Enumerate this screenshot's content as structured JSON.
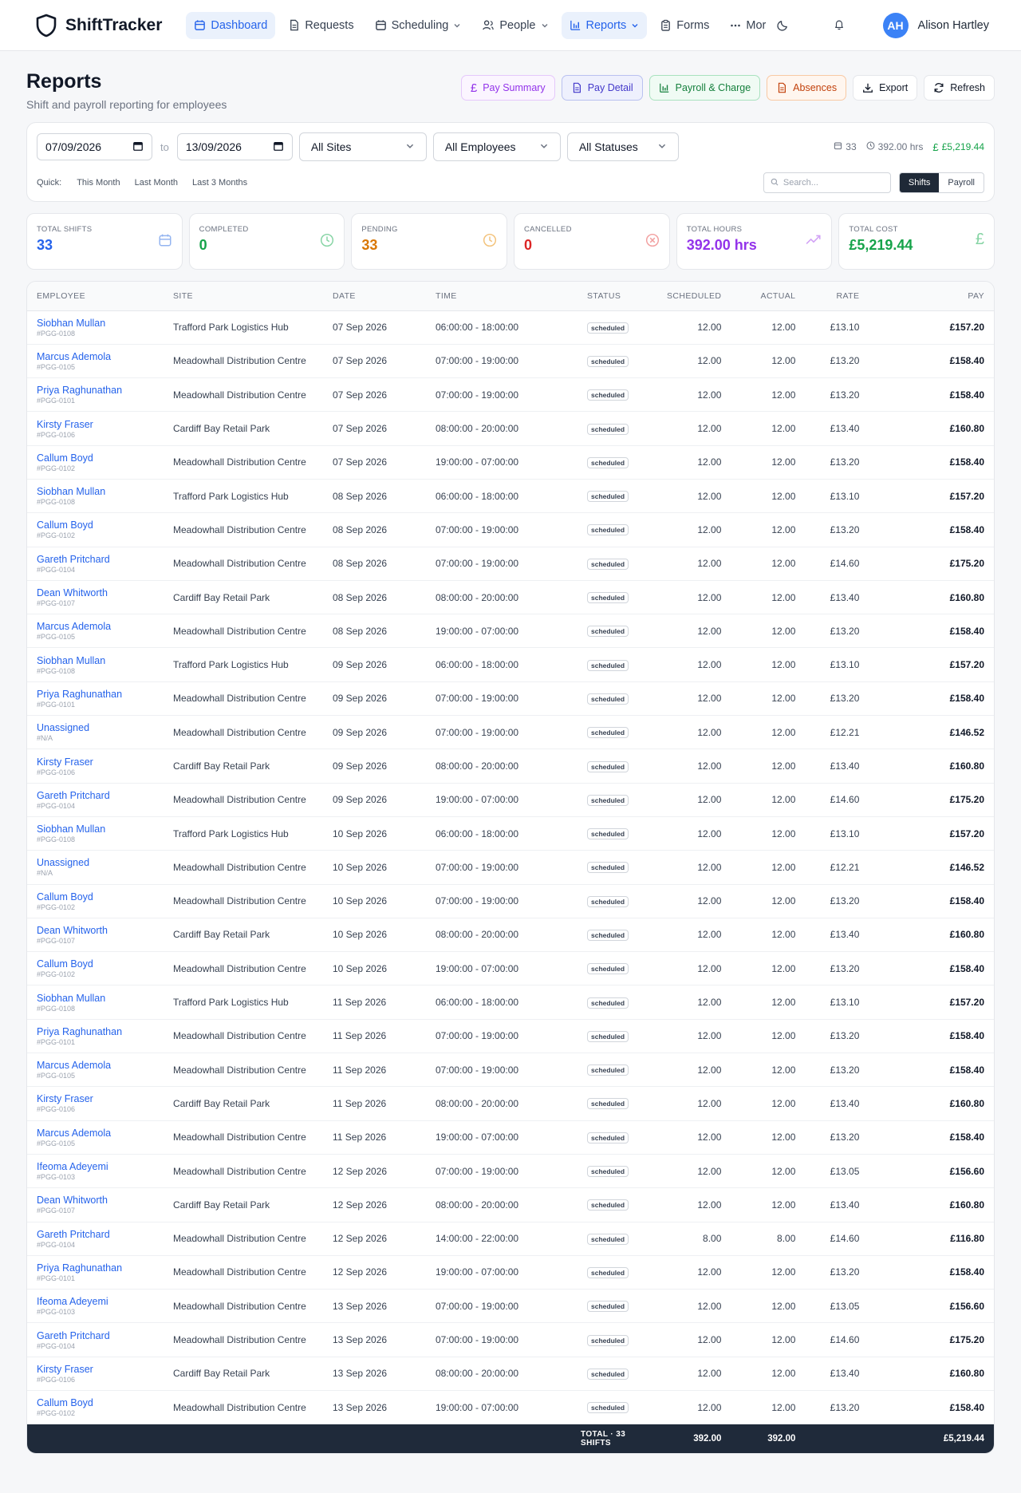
{
  "app": {
    "name": "ShiftTracker"
  },
  "nav": {
    "items": [
      {
        "label": "Dashboard",
        "icon": "calendar-icon",
        "active": true
      },
      {
        "label": "Requests",
        "icon": "document-icon"
      },
      {
        "label": "Scheduling",
        "icon": "calendar-icon",
        "dropdown": true
      },
      {
        "label": "People",
        "icon": "people-icon",
        "dropdown": true
      },
      {
        "label": "Reports",
        "icon": "bar-chart-icon",
        "dropdown": true,
        "active": true
      },
      {
        "label": "Forms",
        "icon": "clipboard-icon"
      },
      {
        "label": "Mor",
        "icon": "more-icon"
      }
    ],
    "user": {
      "initials": "AH",
      "name": "Alison Hartley"
    }
  },
  "page": {
    "title": "Reports",
    "subtitle": "Shift and payroll reporting for employees",
    "buttons": {
      "pay_summary": "Pay Summary",
      "pay_detail": "Pay Detail",
      "payroll_charge": "Payroll & Charge",
      "absences": "Absences",
      "export": "Export",
      "refresh": "Refresh"
    }
  },
  "filters": {
    "date_from": "07/09/2026",
    "to_label": "to",
    "date_to": "13/09/2026",
    "site": "All Sites",
    "employee": "All Employees",
    "status": "All Statuses",
    "summary": {
      "shifts": "33",
      "hours": "392.00 hrs",
      "cost": "£5,219.44"
    },
    "quick_label": "Quick:",
    "quick": [
      "This Month",
      "Last Month",
      "Last 3 Months"
    ],
    "search_placeholder": "Search...",
    "view_shifts": "Shifts",
    "view_payroll": "Payroll"
  },
  "stats": [
    {
      "label": "Total Shifts",
      "value": "33",
      "color": "#2563eb",
      "icon": "calendar-icon"
    },
    {
      "label": "Completed",
      "value": "0",
      "color": "#16a34a",
      "icon": "clock-icon"
    },
    {
      "label": "Pending",
      "value": "33",
      "color": "#d97706",
      "icon": "clock-icon"
    },
    {
      "label": "Cancelled",
      "value": "0",
      "color": "#dc2626",
      "icon": "x-circle-icon"
    },
    {
      "label": "Total Hours",
      "value": "392.00 hrs",
      "color": "#9333ea",
      "icon": "trending-up-icon"
    },
    {
      "label": "Total Cost",
      "value": "£5,219.44",
      "color": "#16a34a",
      "icon": "pound-icon"
    }
  ],
  "table": {
    "headers": [
      "EMPLOYEE",
      "SITE",
      "DATE",
      "TIME",
      "STATUS",
      "SCHEDULED",
      "ACTUAL",
      "RATE",
      "PAY"
    ],
    "rows": [
      {
        "name": "Siobhan Mullan",
        "code": "#PGG-0108",
        "site": "Trafford Park Logistics Hub",
        "date": "07 Sep 2026",
        "time": "06:00:00 - 18:00:00",
        "status": "scheduled",
        "scheduled": "12.00",
        "actual": "12.00",
        "rate": "£13.10",
        "pay": "£157.20"
      },
      {
        "name": "Marcus Ademola",
        "code": "#PGG-0105",
        "site": "Meadowhall Distribution Centre",
        "date": "07 Sep 2026",
        "time": "07:00:00 - 19:00:00",
        "status": "scheduled",
        "scheduled": "12.00",
        "actual": "12.00",
        "rate": "£13.20",
        "pay": "£158.40"
      },
      {
        "name": "Priya Raghunathan",
        "code": "#PGG-0101",
        "site": "Meadowhall Distribution Centre",
        "date": "07 Sep 2026",
        "time": "07:00:00 - 19:00:00",
        "status": "scheduled",
        "scheduled": "12.00",
        "actual": "12.00",
        "rate": "£13.20",
        "pay": "£158.40"
      },
      {
        "name": "Kirsty Fraser",
        "code": "#PGG-0106",
        "site": "Cardiff Bay Retail Park",
        "date": "07 Sep 2026",
        "time": "08:00:00 - 20:00:00",
        "status": "scheduled",
        "scheduled": "12.00",
        "actual": "12.00",
        "rate": "£13.40",
        "pay": "£160.80"
      },
      {
        "name": "Callum Boyd",
        "code": "#PGG-0102",
        "site": "Meadowhall Distribution Centre",
        "date": "07 Sep 2026",
        "time": "19:00:00 - 07:00:00",
        "status": "scheduled",
        "scheduled": "12.00",
        "actual": "12.00",
        "rate": "£13.20",
        "pay": "£158.40"
      },
      {
        "name": "Siobhan Mullan",
        "code": "#PGG-0108",
        "site": "Trafford Park Logistics Hub",
        "date": "08 Sep 2026",
        "time": "06:00:00 - 18:00:00",
        "status": "scheduled",
        "scheduled": "12.00",
        "actual": "12.00",
        "rate": "£13.10",
        "pay": "£157.20"
      },
      {
        "name": "Callum Boyd",
        "code": "#PGG-0102",
        "site": "Meadowhall Distribution Centre",
        "date": "08 Sep 2026",
        "time": "07:00:00 - 19:00:00",
        "status": "scheduled",
        "scheduled": "12.00",
        "actual": "12.00",
        "rate": "£13.20",
        "pay": "£158.40"
      },
      {
        "name": "Gareth Pritchard",
        "code": "#PGG-0104",
        "site": "Meadowhall Distribution Centre",
        "date": "08 Sep 2026",
        "time": "07:00:00 - 19:00:00",
        "status": "scheduled",
        "scheduled": "12.00",
        "actual": "12.00",
        "rate": "£14.60",
        "pay": "£175.20"
      },
      {
        "name": "Dean Whitworth",
        "code": "#PGG-0107",
        "site": "Cardiff Bay Retail Park",
        "date": "08 Sep 2026",
        "time": "08:00:00 - 20:00:00",
        "status": "scheduled",
        "scheduled": "12.00",
        "actual": "12.00",
        "rate": "£13.40",
        "pay": "£160.80"
      },
      {
        "name": "Marcus Ademola",
        "code": "#PGG-0105",
        "site": "Meadowhall Distribution Centre",
        "date": "08 Sep 2026",
        "time": "19:00:00 - 07:00:00",
        "status": "scheduled",
        "scheduled": "12.00",
        "actual": "12.00",
        "rate": "£13.20",
        "pay": "£158.40"
      },
      {
        "name": "Siobhan Mullan",
        "code": "#PGG-0108",
        "site": "Trafford Park Logistics Hub",
        "date": "09 Sep 2026",
        "time": "06:00:00 - 18:00:00",
        "status": "scheduled",
        "scheduled": "12.00",
        "actual": "12.00",
        "rate": "£13.10",
        "pay": "£157.20"
      },
      {
        "name": "Priya Raghunathan",
        "code": "#PGG-0101",
        "site": "Meadowhall Distribution Centre",
        "date": "09 Sep 2026",
        "time": "07:00:00 - 19:00:00",
        "status": "scheduled",
        "scheduled": "12.00",
        "actual": "12.00",
        "rate": "£13.20",
        "pay": "£158.40"
      },
      {
        "name": "Unassigned",
        "code": "#N/A",
        "site": "Meadowhall Distribution Centre",
        "date": "09 Sep 2026",
        "time": "07:00:00 - 19:00:00",
        "status": "scheduled",
        "scheduled": "12.00",
        "actual": "12.00",
        "rate": "£12.21",
        "pay": "£146.52"
      },
      {
        "name": "Kirsty Fraser",
        "code": "#PGG-0106",
        "site": "Cardiff Bay Retail Park",
        "date": "09 Sep 2026",
        "time": "08:00:00 - 20:00:00",
        "status": "scheduled",
        "scheduled": "12.00",
        "actual": "12.00",
        "rate": "£13.40",
        "pay": "£160.80"
      },
      {
        "name": "Gareth Pritchard",
        "code": "#PGG-0104",
        "site": "Meadowhall Distribution Centre",
        "date": "09 Sep 2026",
        "time": "19:00:00 - 07:00:00",
        "status": "scheduled",
        "scheduled": "12.00",
        "actual": "12.00",
        "rate": "£14.60",
        "pay": "£175.20"
      },
      {
        "name": "Siobhan Mullan",
        "code": "#PGG-0108",
        "site": "Trafford Park Logistics Hub",
        "date": "10 Sep 2026",
        "time": "06:00:00 - 18:00:00",
        "status": "scheduled",
        "scheduled": "12.00",
        "actual": "12.00",
        "rate": "£13.10",
        "pay": "£157.20"
      },
      {
        "name": "Unassigned",
        "code": "#N/A",
        "site": "Meadowhall Distribution Centre",
        "date": "10 Sep 2026",
        "time": "07:00:00 - 19:00:00",
        "status": "scheduled",
        "scheduled": "12.00",
        "actual": "12.00",
        "rate": "£12.21",
        "pay": "£146.52"
      },
      {
        "name": "Callum Boyd",
        "code": "#PGG-0102",
        "site": "Meadowhall Distribution Centre",
        "date": "10 Sep 2026",
        "time": "07:00:00 - 19:00:00",
        "status": "scheduled",
        "scheduled": "12.00",
        "actual": "12.00",
        "rate": "£13.20",
        "pay": "£158.40"
      },
      {
        "name": "Dean Whitworth",
        "code": "#PGG-0107",
        "site": "Cardiff Bay Retail Park",
        "date": "10 Sep 2026",
        "time": "08:00:00 - 20:00:00",
        "status": "scheduled",
        "scheduled": "12.00",
        "actual": "12.00",
        "rate": "£13.40",
        "pay": "£160.80"
      },
      {
        "name": "Callum Boyd",
        "code": "#PGG-0102",
        "site": "Meadowhall Distribution Centre",
        "date": "10 Sep 2026",
        "time": "19:00:00 - 07:00:00",
        "status": "scheduled",
        "scheduled": "12.00",
        "actual": "12.00",
        "rate": "£13.20",
        "pay": "£158.40"
      },
      {
        "name": "Siobhan Mullan",
        "code": "#PGG-0108",
        "site": "Trafford Park Logistics Hub",
        "date": "11 Sep 2026",
        "time": "06:00:00 - 18:00:00",
        "status": "scheduled",
        "scheduled": "12.00",
        "actual": "12.00",
        "rate": "£13.10",
        "pay": "£157.20"
      },
      {
        "name": "Priya Raghunathan",
        "code": "#PGG-0101",
        "site": "Meadowhall Distribution Centre",
        "date": "11 Sep 2026",
        "time": "07:00:00 - 19:00:00",
        "status": "scheduled",
        "scheduled": "12.00",
        "actual": "12.00",
        "rate": "£13.20",
        "pay": "£158.40"
      },
      {
        "name": "Marcus Ademola",
        "code": "#PGG-0105",
        "site": "Meadowhall Distribution Centre",
        "date": "11 Sep 2026",
        "time": "07:00:00 - 19:00:00",
        "status": "scheduled",
        "scheduled": "12.00",
        "actual": "12.00",
        "rate": "£13.20",
        "pay": "£158.40"
      },
      {
        "name": "Kirsty Fraser",
        "code": "#PGG-0106",
        "site": "Cardiff Bay Retail Park",
        "date": "11 Sep 2026",
        "time": "08:00:00 - 20:00:00",
        "status": "scheduled",
        "scheduled": "12.00",
        "actual": "12.00",
        "rate": "£13.40",
        "pay": "£160.80"
      },
      {
        "name": "Marcus Ademola",
        "code": "#PGG-0105",
        "site": "Meadowhall Distribution Centre",
        "date": "11 Sep 2026",
        "time": "19:00:00 - 07:00:00",
        "status": "scheduled",
        "scheduled": "12.00",
        "actual": "12.00",
        "rate": "£13.20",
        "pay": "£158.40"
      },
      {
        "name": "Ifeoma Adeyemi",
        "code": "#PGG-0103",
        "site": "Meadowhall Distribution Centre",
        "date": "12 Sep 2026",
        "time": "07:00:00 - 19:00:00",
        "status": "scheduled",
        "scheduled": "12.00",
        "actual": "12.00",
        "rate": "£13.05",
        "pay": "£156.60"
      },
      {
        "name": "Dean Whitworth",
        "code": "#PGG-0107",
        "site": "Cardiff Bay Retail Park",
        "date": "12 Sep 2026",
        "time": "08:00:00 - 20:00:00",
        "status": "scheduled",
        "scheduled": "12.00",
        "actual": "12.00",
        "rate": "£13.40",
        "pay": "£160.80"
      },
      {
        "name": "Gareth Pritchard",
        "code": "#PGG-0104",
        "site": "Meadowhall Distribution Centre",
        "date": "12 Sep 2026",
        "time": "14:00:00 - 22:00:00",
        "status": "scheduled",
        "scheduled": "8.00",
        "actual": "8.00",
        "rate": "£14.60",
        "pay": "£116.80"
      },
      {
        "name": "Priya Raghunathan",
        "code": "#PGG-0101",
        "site": "Meadowhall Distribution Centre",
        "date": "12 Sep 2026",
        "time": "19:00:00 - 07:00:00",
        "status": "scheduled",
        "scheduled": "12.00",
        "actual": "12.00",
        "rate": "£13.20",
        "pay": "£158.40"
      },
      {
        "name": "Ifeoma Adeyemi",
        "code": "#PGG-0103",
        "site": "Meadowhall Distribution Centre",
        "date": "13 Sep 2026",
        "time": "07:00:00 - 19:00:00",
        "status": "scheduled",
        "scheduled": "12.00",
        "actual": "12.00",
        "rate": "£13.05",
        "pay": "£156.60"
      },
      {
        "name": "Gareth Pritchard",
        "code": "#PGG-0104",
        "site": "Meadowhall Distribution Centre",
        "date": "13 Sep 2026",
        "time": "07:00:00 - 19:00:00",
        "status": "scheduled",
        "scheduled": "12.00",
        "actual": "12.00",
        "rate": "£14.60",
        "pay": "£175.20"
      },
      {
        "name": "Kirsty Fraser",
        "code": "#PGG-0106",
        "site": "Cardiff Bay Retail Park",
        "date": "13 Sep 2026",
        "time": "08:00:00 - 20:00:00",
        "status": "scheduled",
        "scheduled": "12.00",
        "actual": "12.00",
        "rate": "£13.40",
        "pay": "£160.80"
      },
      {
        "name": "Callum Boyd",
        "code": "#PGG-0102",
        "site": "Meadowhall Distribution Centre",
        "date": "13 Sep 2026",
        "time": "19:00:00 - 07:00:00",
        "status": "scheduled",
        "scheduled": "12.00",
        "actual": "12.00",
        "rate": "£13.20",
        "pay": "£158.40"
      }
    ],
    "footer": {
      "label": "TOTAL · 33 SHIFTS",
      "scheduled": "392.00",
      "actual": "392.00",
      "pay": "£5,219.44"
    }
  }
}
